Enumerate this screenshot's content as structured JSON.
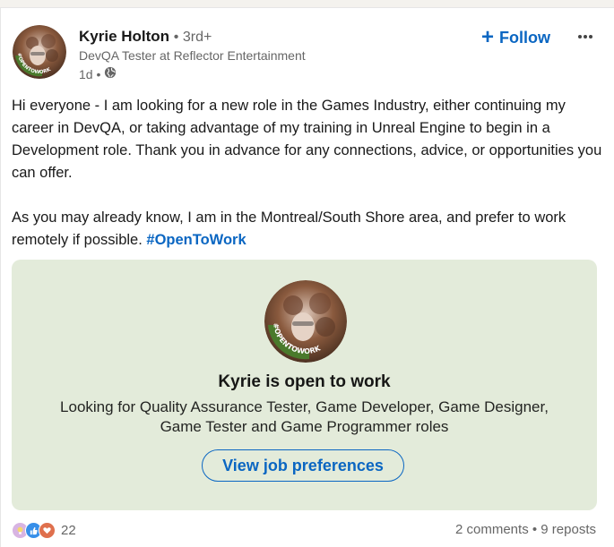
{
  "post": {
    "author_name": "Kyrie Holton",
    "degree": "• 3rd+",
    "headline": "DevQA Tester at Reflector Entertainment",
    "time": "1d •",
    "visibility_icon": "globe-icon",
    "follow_label": "Follow",
    "follow_icon": "plus-icon",
    "more_icon": "ellipsis-icon",
    "paragraph_1": "Hi everyone - I am looking for a new role in the Games Industry, either continuing my career in DevQA, or taking advantage of my training in Unreal Engine to begin in a Development role. Thank you in advance for any connections, advice, or opportunities you can offer.",
    "paragraph_2": "As you may already know, I am in the Montreal/South Shore area, and prefer to work remotely if possible.",
    "hashtag": "#OpenToWork",
    "avatar_frame_text": "#OPENTOWORK"
  },
  "open_to_work": {
    "title": "Kyrie is open to work",
    "description_line_1": "Looking for Quality Assurance Tester, Game Developer, Game Designer,",
    "description_line_2": "Game Tester and Game Programmer roles",
    "button_label": "View job preferences"
  },
  "footer": {
    "reaction_count": "22",
    "comments": "2 comments",
    "separator": " • ",
    "reposts": "9 reposts"
  },
  "colors": {
    "brand_blue": "#0a66c2",
    "open_to_work_green": "#4a7a2c",
    "card_background": "#e3ebda"
  }
}
